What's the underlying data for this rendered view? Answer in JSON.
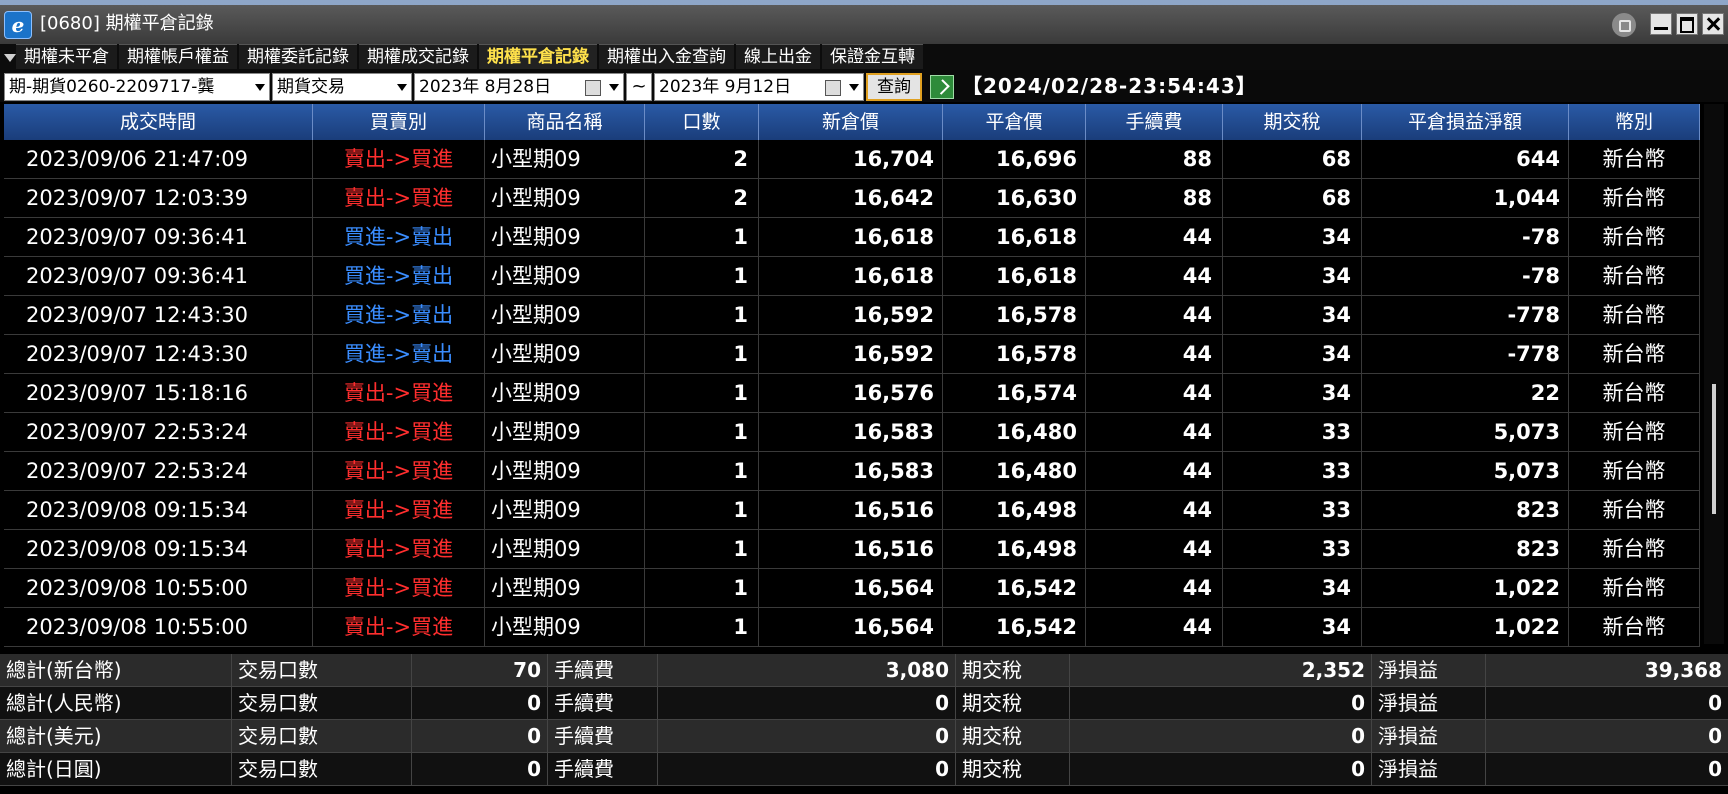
{
  "window": {
    "title": "[0680] 期權平倉記錄",
    "logo": "e"
  },
  "tabs": [
    {
      "label": "期權未平倉",
      "active": false
    },
    {
      "label": "期權帳戶權益",
      "active": false
    },
    {
      "label": "期權委託記錄",
      "active": false
    },
    {
      "label": "期權成交記錄",
      "active": false
    },
    {
      "label": "期權平倉記錄",
      "active": true
    },
    {
      "label": "期權出入金查詢",
      "active": false
    },
    {
      "label": "線上出金",
      "active": false
    },
    {
      "label": "保證金互轉",
      "active": false
    }
  ],
  "toolbar": {
    "account": "期-期貨0260-2209717-龔",
    "trade_type": "期貨交易",
    "date_from": "2023年  8月28日",
    "tilde": "~",
    "date_to": "2023年  9月12日",
    "query_label": "查詢",
    "timestamp": "【2024/02/28-23:54:43】"
  },
  "table": {
    "columns": [
      "成交時間",
      "買賣別",
      "商品名稱",
      "口數",
      "新倉價",
      "平倉價",
      "手續費",
      "期交稅",
      "平倉損益淨額",
      "幣別"
    ],
    "rows": [
      [
        "2023/09/06 21:47:09",
        "賣出->買進",
        "小型期09",
        "2",
        "16,704",
        "16,696",
        "88",
        "68",
        "644",
        "新台幣"
      ],
      [
        "2023/09/07 12:03:39",
        "賣出->買進",
        "小型期09",
        "2",
        "16,642",
        "16,630",
        "88",
        "68",
        "1,044",
        "新台幣"
      ],
      [
        "2023/09/07 09:36:41",
        "買進->賣出",
        "小型期09",
        "1",
        "16,618",
        "16,618",
        "44",
        "34",
        "-78",
        "新台幣"
      ],
      [
        "2023/09/07 09:36:41",
        "買進->賣出",
        "小型期09",
        "1",
        "16,618",
        "16,618",
        "44",
        "34",
        "-78",
        "新台幣"
      ],
      [
        "2023/09/07 12:43:30",
        "買進->賣出",
        "小型期09",
        "1",
        "16,592",
        "16,578",
        "44",
        "34",
        "-778",
        "新台幣"
      ],
      [
        "2023/09/07 12:43:30",
        "買進->賣出",
        "小型期09",
        "1",
        "16,592",
        "16,578",
        "44",
        "34",
        "-778",
        "新台幣"
      ],
      [
        "2023/09/07 15:18:16",
        "賣出->買進",
        "小型期09",
        "1",
        "16,576",
        "16,574",
        "44",
        "34",
        "22",
        "新台幣"
      ],
      [
        "2023/09/07 22:53:24",
        "賣出->買進",
        "小型期09",
        "1",
        "16,583",
        "16,480",
        "44",
        "33",
        "5,073",
        "新台幣"
      ],
      [
        "2023/09/07 22:53:24",
        "賣出->買進",
        "小型期09",
        "1",
        "16,583",
        "16,480",
        "44",
        "33",
        "5,073",
        "新台幣"
      ],
      [
        "2023/09/08 09:15:34",
        "賣出->買進",
        "小型期09",
        "1",
        "16,516",
        "16,498",
        "44",
        "33",
        "823",
        "新台幣"
      ],
      [
        "2023/09/08 09:15:34",
        "賣出->買進",
        "小型期09",
        "1",
        "16,516",
        "16,498",
        "44",
        "33",
        "823",
        "新台幣"
      ],
      [
        "2023/09/08 10:55:00",
        "賣出->買進",
        "小型期09",
        "1",
        "16,564",
        "16,542",
        "44",
        "34",
        "1,022",
        "新台幣"
      ],
      [
        "2023/09/08 10:55:00",
        "賣出->買進",
        "小型期09",
        "1",
        "16,564",
        "16,542",
        "44",
        "34",
        "1,022",
        "新台幣"
      ]
    ]
  },
  "totals": [
    {
      "label": "總計(新台幣)",
      "qty_label": "交易口數",
      "qty": "70",
      "fee_label": "手續費",
      "fee": "3,080",
      "tax_label": "期交稅",
      "tax": "2,352",
      "net_label": "淨損益",
      "net": "39,368"
    },
    {
      "label": "總計(人民幣)",
      "qty_label": "交易口數",
      "qty": "0",
      "fee_label": "手續費",
      "fee": "0",
      "tax_label": "期交稅",
      "tax": "0",
      "net_label": "淨損益",
      "net": "0"
    },
    {
      "label": "總計(美元)",
      "qty_label": "交易口數",
      "qty": "0",
      "fee_label": "手續費",
      "fee": "0",
      "tax_label": "期交稅",
      "tax": "0",
      "net_label": "淨損益",
      "net": "0"
    },
    {
      "label": "總計(日圓)",
      "qty_label": "交易口數",
      "qty": "0",
      "fee_label": "手續費",
      "fee": "0",
      "tax_label": "期交稅",
      "tax": "0",
      "net_label": "淨損益",
      "net": "0"
    }
  ],
  "colors": {
    "sell_buy": "#ff2e2e",
    "buy_sell": "#3a8dff",
    "active_tab": "#ffe14b",
    "header": "#2a5aa6"
  }
}
